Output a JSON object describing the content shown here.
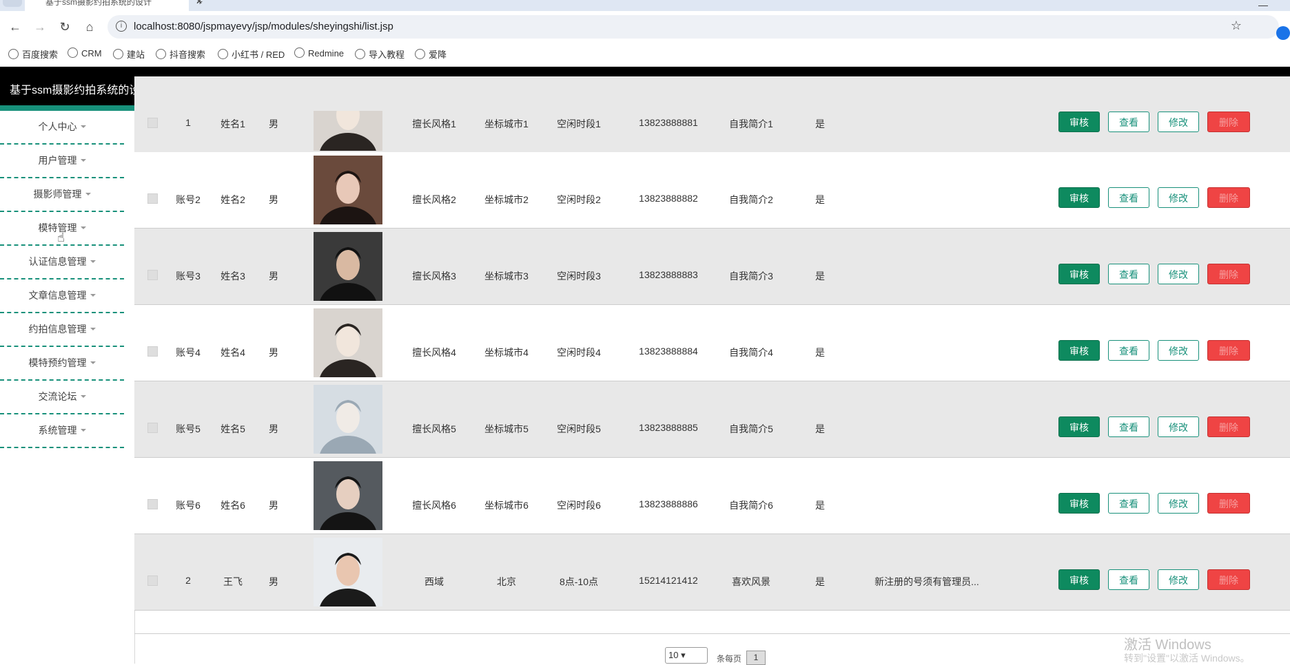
{
  "browser": {
    "tab_title": "基于ssm摄影约拍系统的设计",
    "url": "localhost:8080/jspmayevy/jsp/modules/sheyingshi/list.jsp",
    "bookmarks": [
      "百度搜索",
      "CRM",
      "建站",
      "抖音搜索",
      "小红书 / RED",
      "Redmine",
      "导入教程",
      "爱降"
    ]
  },
  "app": {
    "title": "基于ssm摄影约拍系统的设计",
    "accent_color": "#17907a"
  },
  "sidebar": {
    "items": [
      {
        "label": "个人中心"
      },
      {
        "label": "用户管理"
      },
      {
        "label": "摄影师管理"
      },
      {
        "label": "模特管理"
      },
      {
        "label": "认证信息管理"
      },
      {
        "label": "文章信息管理"
      },
      {
        "label": "约拍信息管理"
      },
      {
        "label": "模特预约管理"
      },
      {
        "label": "交流论坛"
      },
      {
        "label": "系统管理"
      }
    ]
  },
  "table": {
    "buttons": {
      "audit": "审核",
      "view": "查看",
      "edit": "修改",
      "delete": "删除"
    },
    "rows": [
      {
        "account": "1",
        "name": "姓名1",
        "gender": "男",
        "style": "擅长风格1",
        "city": "坐标城市1",
        "time": "空闲时段1",
        "phone": "13823888881",
        "intro": "自我简介1",
        "status": "是",
        "remark": "",
        "photo": "young man in car"
      },
      {
        "account": "账号2",
        "name": "姓名2",
        "gender": "男",
        "style": "擅长风格2",
        "city": "坐标城市2",
        "time": "空闲时段2",
        "phone": "13823888882",
        "intro": "自我简介2",
        "status": "是",
        "remark": "",
        "photo": "woman in dark jacket"
      },
      {
        "account": "账号3",
        "name": "姓名3",
        "gender": "男",
        "style": "擅长风格3",
        "city": "坐标城市3",
        "time": "空闲时段3",
        "phone": "13823888883",
        "intro": "自我简介3",
        "status": "是",
        "remark": "",
        "photo": "man in black shirt"
      },
      {
        "account": "账号4",
        "name": "姓名4",
        "gender": "男",
        "style": "擅长风格4",
        "city": "坐标城市4",
        "time": "空闲时段4",
        "phone": "13823888884",
        "intro": "自我简介4",
        "status": "是",
        "remark": "",
        "photo": "young man in car"
      },
      {
        "account": "账号5",
        "name": "姓名5",
        "gender": "男",
        "style": "擅长风格5",
        "city": "坐标城市5",
        "time": "空闲时段5",
        "phone": "13823888885",
        "intro": "自我简介5",
        "status": "是",
        "remark": "",
        "photo": "woman by the sea"
      },
      {
        "account": "账号6",
        "name": "姓名6",
        "gender": "男",
        "style": "擅长风格6",
        "city": "坐标城市6",
        "time": "空闲时段6",
        "phone": "13823888886",
        "intro": "自我简介6",
        "status": "是",
        "remark": "",
        "photo": "man in dark coat"
      },
      {
        "account": "2",
        "name": "王飞",
        "gender": "男",
        "style": "西域",
        "city": "北京",
        "time": "8点-10点",
        "phone": "15214121412",
        "intro": "喜欢风景",
        "status": "是",
        "remark": "新注册的号须有管理员...",
        "photo": "man in suit portrait"
      }
    ]
  },
  "pager": {
    "page_size": "10",
    "per_page_label": "条每页",
    "current_page": "1"
  },
  "watermark": {
    "line1": "激活 Windows",
    "line2": "转到\"设置\"以激活 Windows。"
  }
}
